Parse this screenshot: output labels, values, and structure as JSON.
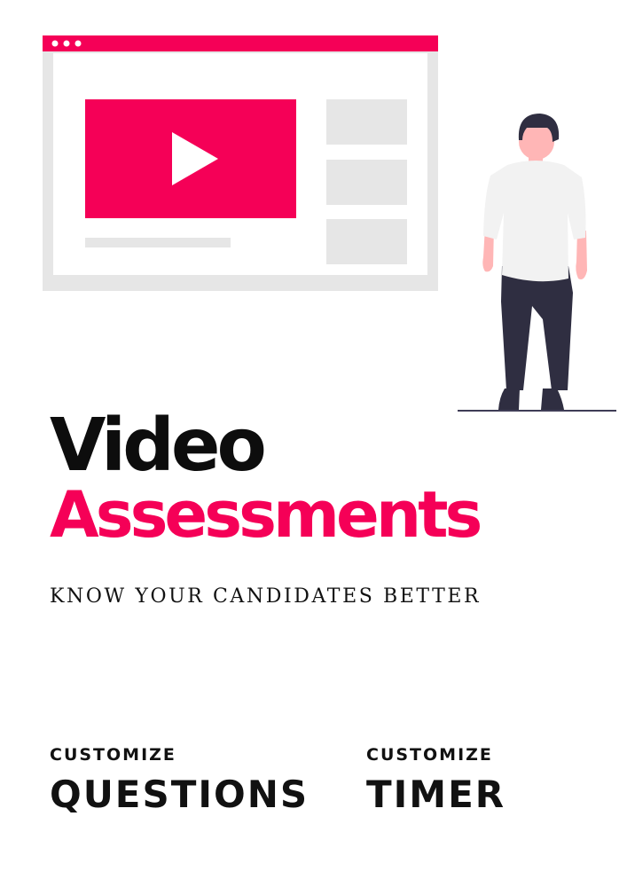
{
  "hero": {
    "title_line1": "Video",
    "title_line2": "Assessments",
    "tagline": "KNOW YOUR CANDIDATES BETTER"
  },
  "features": [
    {
      "small": "CUSTOMIZE",
      "big": "QUESTIONS"
    },
    {
      "small": "CUSTOMIZE",
      "big": "TIMER"
    }
  ],
  "colors": {
    "accent": "#f50057",
    "text": "#0d0d0d",
    "panel": "#e6e6e6"
  },
  "icons": {
    "browser": "browser-window-icon",
    "play": "play-icon",
    "person": "person-illustration"
  }
}
